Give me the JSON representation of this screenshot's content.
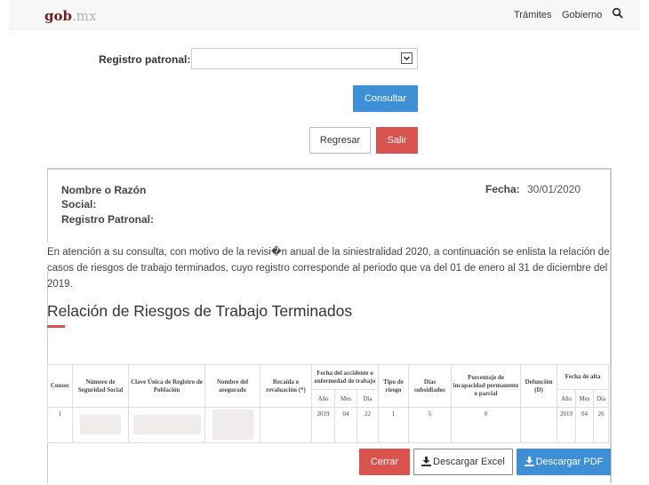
{
  "header": {
    "logo_main": "gob",
    "logo_suffix": ".mx",
    "nav": [
      "Trámites",
      "Gobierno"
    ],
    "search_icon": "search-icon"
  },
  "form": {
    "registro_label": "Registro patronal:",
    "registro_value": "",
    "consultar_label": "Consultar",
    "regresar_label": "Regresar",
    "salir_label": "Salir"
  },
  "panel": {
    "nombre_label": "Nombre o Razón Social:",
    "registro_label": "Registro Patronal:",
    "fecha_label": "Fecha:",
    "fecha_value": "30/01/2020",
    "paragraph": "En atención a su consulta, con motivo de la revisi�n anual de la siniestralidad 2020, a continuación se enlista la relación de casos de riesgos de trabajo terminados, cuyo registro corresponde al periodo que va del 01 de enero al 31 de diciembre del 2019.",
    "section_title": "Relación de Riesgos de Trabajo Terminados"
  },
  "table": {
    "headers": {
      "consec": "Consec",
      "nss": "Número de Seguridad Social",
      "curp": "Clave Única de Registro de Población",
      "nombre": "Nombre del asegurado",
      "recaida": "Recaída o revaluación (*)",
      "fecha_accidente": "Fecha del accidente o enfermedad de trabajo",
      "tipo": "Tipo de riesgo",
      "dias": "Días subsidiados",
      "porcentaje": "Porcentaje de incapacidad permanente o parcial",
      "defuncion": "Defunción (D)",
      "fecha_alta": "Fecha de alta"
    },
    "subheaders": [
      "Año",
      "Mes",
      "Día"
    ],
    "rows": [
      {
        "consec": "1",
        "nss": "",
        "curp": "",
        "nombre": "",
        "recaida": "",
        "acc_anio": "2019",
        "acc_mes": "04",
        "acc_dia": "22",
        "tipo": "1",
        "dias": "5",
        "porcentaje": "0",
        "defuncion": "",
        "alta_anio": "2019",
        "alta_mes": "04",
        "alta_dia": "26"
      }
    ]
  },
  "actions": {
    "cerrar_label": "Cerrar",
    "excel_label": "Descargar Excel",
    "pdf_label": "Descargar PDF"
  },
  "colors": {
    "primary": "#3d8fd6",
    "danger": "#d9534f",
    "brand": "#6f1d1b"
  }
}
